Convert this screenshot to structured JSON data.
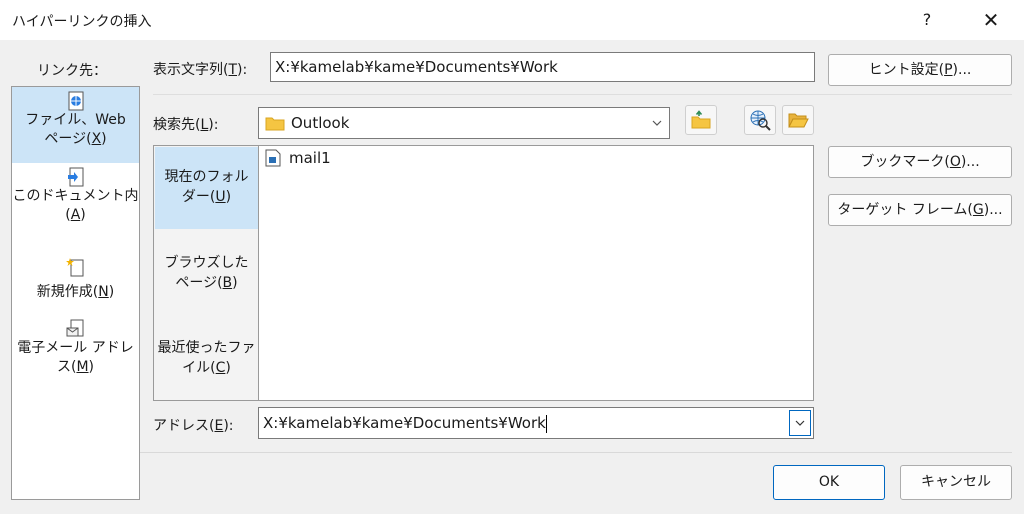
{
  "window": {
    "title": "ハイパーリンクの挿入",
    "help_label": "?",
    "close_label": "✕"
  },
  "left_panel": {
    "header": "リンク先：",
    "items": [
      {
        "line1": "ファイル、Web",
        "line2_pre": "ページ(",
        "hotkey": "X",
        "line2_post": ")"
      },
      {
        "line1": "このドキュメント内",
        "line2_pre": "(",
        "hotkey": "A",
        "line2_post": ")"
      },
      {
        "line1": "",
        "line2_pre": "新規作成(",
        "hotkey": "N",
        "line2_post": ")"
      },
      {
        "line1": "電子メール アドレ",
        "line2_pre": "ス(",
        "hotkey": "M",
        "line2_post": ")"
      }
    ]
  },
  "display_text": {
    "label_pre": "表示文字列(",
    "label_hotkey": "T",
    "label_post": "):",
    "value": "X:¥kamelab¥kame¥Documents¥Work"
  },
  "search_in": {
    "label_pre": "検索先(",
    "label_hotkey": "L",
    "label_post": "):",
    "value": "Outlook"
  },
  "mid_panel": {
    "items": [
      {
        "line1": "現在のフォル",
        "line2_pre": "ダー(",
        "hotkey": "U",
        "line2_post": ")"
      },
      {
        "line1": "ブラウズした",
        "line2_pre": "ページ(",
        "hotkey": "B",
        "line2_post": ")"
      },
      {
        "line1": "最近使ったファ",
        "line2_pre": "イル(",
        "hotkey": "C",
        "line2_post": ")"
      }
    ]
  },
  "file_list": {
    "items": [
      {
        "name": "mail1"
      }
    ]
  },
  "address": {
    "label_pre": "アドレス(",
    "label_hotkey": "E",
    "label_post": "):",
    "value": "X:¥kamelab¥kame¥Documents¥Work"
  },
  "buttons": {
    "hint_pre": "ヒント設定(",
    "hint_hotkey": "P",
    "hint_post": ")...",
    "bookmark_pre": "ブックマーク(",
    "bookmark_hotkey": "O",
    "bookmark_post": ")...",
    "target_pre": "ターゲット フレーム(",
    "target_hotkey": "G",
    "target_post": ")...",
    "ok": "OK",
    "cancel": "キャンセル"
  },
  "colors": {
    "selected_bg": "#cce4f7",
    "primary_border": "#0067c0",
    "folder_yellow": "#f5c542"
  },
  "icons": {
    "up_folder": "folder-up-icon",
    "browse_web": "browse-web-icon",
    "browse_file": "browse-file-icon"
  }
}
